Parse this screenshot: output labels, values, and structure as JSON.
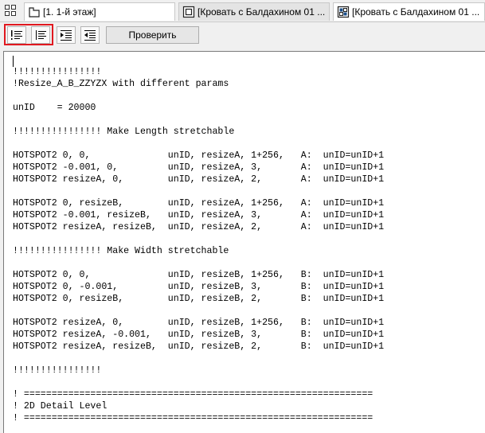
{
  "tabs": [
    {
      "label": "[1. 1-й этаж]",
      "icon": "floor-plan-icon"
    },
    {
      "label": "[Кровать с Балдахином 01 ...",
      "icon": "object-window-icon"
    },
    {
      "label": "[Кровать с Балдахином 01 ...",
      "icon": "object-3d-icon"
    }
  ],
  "toolbar": {
    "check_label": "Проверить",
    "buttons": [
      "comment-lines-icon",
      "uncomment-lines-icon",
      "indent-icon",
      "outdent-icon"
    ]
  },
  "code_lines": [
    "!!!!!!!!!!!!!!!!",
    "!Resize_A_B_ZZYZX with different params",
    "",
    "unID    = 20000",
    "",
    "!!!!!!!!!!!!!!!! Make Length stretchable",
    "",
    "HOTSPOT2 0, 0,              unID, resizeA, 1+256,   A:  unID=unID+1",
    "HOTSPOT2 -0.001, 0,         unID, resizeA, 3,       A:  unID=unID+1",
    "HOTSPOT2 resizeA, 0,        unID, resizeA, 2,       A:  unID=unID+1",
    "",
    "HOTSPOT2 0, resizeB,        unID, resizeA, 1+256,   A:  unID=unID+1",
    "HOTSPOT2 -0.001, resizeB,   unID, resizeA, 3,       A:  unID=unID+1",
    "HOTSPOT2 resizeA, resizeB,  unID, resizeA, 2,       A:  unID=unID+1",
    "",
    "!!!!!!!!!!!!!!!! Make Width stretchable",
    "",
    "HOTSPOT2 0, 0,              unID, resizeB, 1+256,   B:  unID=unID+1",
    "HOTSPOT2 0, -0.001,         unID, resizeB, 3,       B:  unID=unID+1",
    "HOTSPOT2 0, resizeB,        unID, resizeB, 2,       B:  unID=unID+1",
    "",
    "HOTSPOT2 resizeA, 0,        unID, resizeB, 1+256,   B:  unID=unID+1",
    "HOTSPOT2 resizeA, -0.001,   unID, resizeB, 3,       B:  unID=unID+1",
    "HOTSPOT2 resizeA, resizeB,  unID, resizeB, 2,       B:  unID=unID+1",
    "",
    "!!!!!!!!!!!!!!!!",
    "",
    "! ===============================================================",
    "! 2D Detail Level",
    "! ==============================================================="
  ]
}
